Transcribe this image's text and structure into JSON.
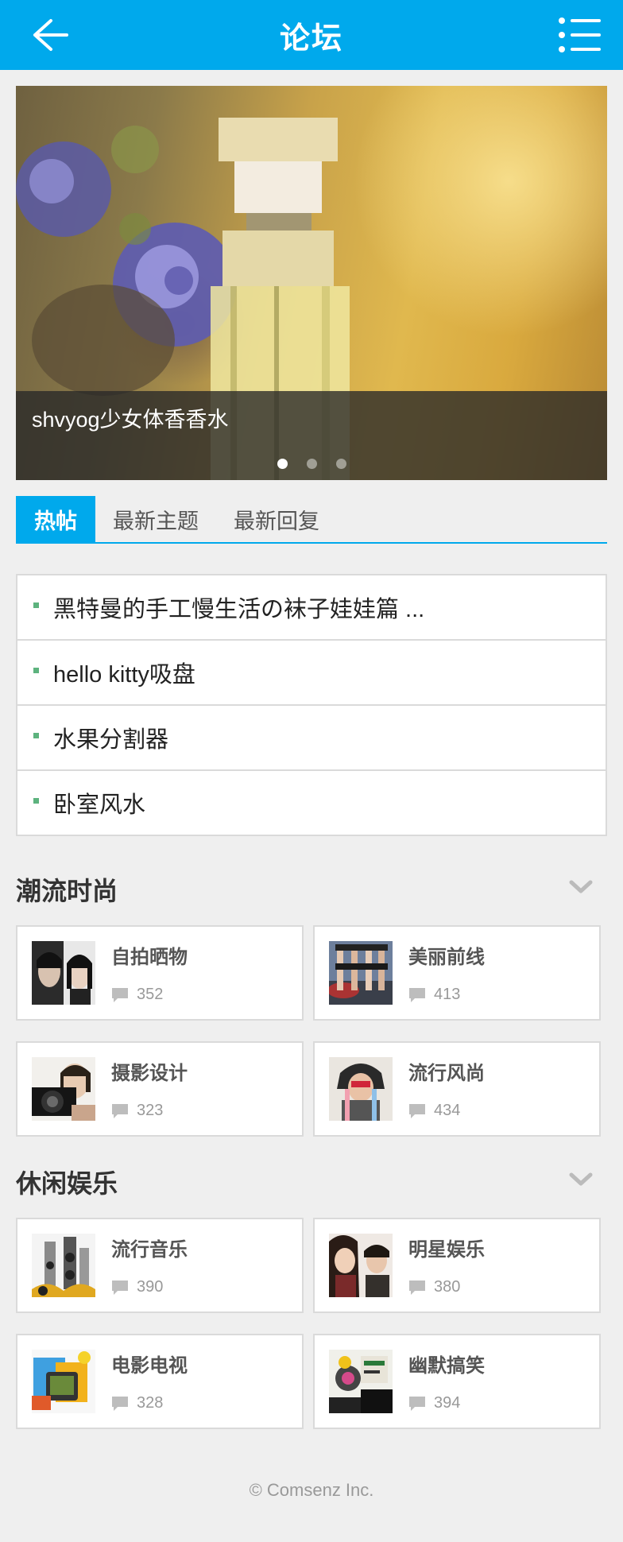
{
  "header": {
    "title": "论坛"
  },
  "banner": {
    "caption": "shvyog少女体香香水",
    "dots_total": 3,
    "dots_active": 1
  },
  "tabs": [
    {
      "label": "热帖",
      "active": true
    },
    {
      "label": "最新主题",
      "active": false
    },
    {
      "label": "最新回复",
      "active": false
    }
  ],
  "hot_threads": [
    "黑特曼的手工慢生活の袜子娃娃篇 ...",
    "hello kitty吸盘",
    "水果分割器",
    "卧室风水"
  ],
  "sections": [
    {
      "title": "潮流时尚",
      "forums": [
        {
          "name": "自拍晒物",
          "count": "352"
        },
        {
          "name": "美丽前线",
          "count": "413"
        },
        {
          "name": "摄影设计",
          "count": "323"
        },
        {
          "name": "流行风尚",
          "count": "434"
        }
      ]
    },
    {
      "title": "休闲娱乐",
      "forums": [
        {
          "name": "流行音乐",
          "count": "390"
        },
        {
          "name": "明星娱乐",
          "count": "380"
        },
        {
          "name": "电影电视",
          "count": "328"
        },
        {
          "name": "幽默搞笑",
          "count": "394"
        }
      ]
    }
  ],
  "footer": {
    "copyright": "© Comsenz Inc."
  },
  "colors": {
    "accent": "#00a9ec",
    "bullet": "#5db37e",
    "background": "#efefef"
  },
  "icons": {
    "back": "arrow-left-icon",
    "menu": "list-menu-icon",
    "collapse": "chevron-down-icon",
    "reply": "comment-bubble-icon"
  }
}
